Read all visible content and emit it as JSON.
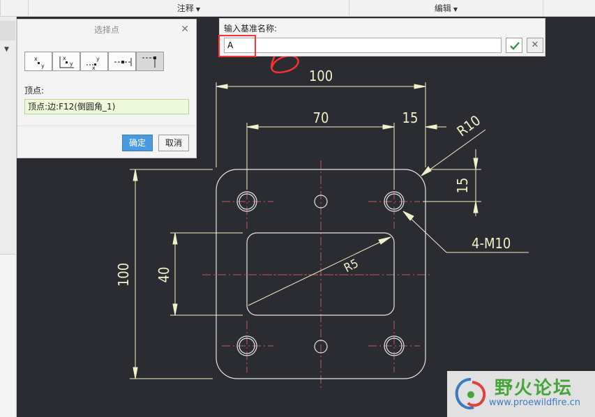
{
  "ribbon": {
    "annotate_label": "注释",
    "edit_label": "编辑"
  },
  "select_point_dialog": {
    "title": "选择点",
    "vertex_label": "顶点:",
    "vertex_value": "顶点:边:F12(倒圆角_1)",
    "ok_label": "确定",
    "cancel_label": "取消",
    "tool_icons": [
      "xy-coord-icon",
      "xy-corner-icon",
      "xy-offset-icon",
      "on-edge-icon",
      "vertex-icon"
    ]
  },
  "datum_name_bar": {
    "label": "输入基准名称:",
    "value": "A"
  },
  "annotation": {
    "handwritten_number": "6"
  },
  "drawing": {
    "dimensions": {
      "overall_width": "100",
      "overall_height": "100",
      "hole_spacing": "70",
      "hole_offset_x": "15",
      "hole_offset_y": "15",
      "corner_radius": "R10",
      "hole_callout": "4-M10",
      "slot_height": "40",
      "slot_radius": "R5"
    },
    "colors": {
      "part_outline": "#e6e6e6",
      "dimension": "#f2f0c8",
      "centerline": "#c05a5a",
      "highlight": "#ff3030"
    }
  },
  "watermark": {
    "title": "野火论坛",
    "url": "www.proewildfire.cn"
  }
}
